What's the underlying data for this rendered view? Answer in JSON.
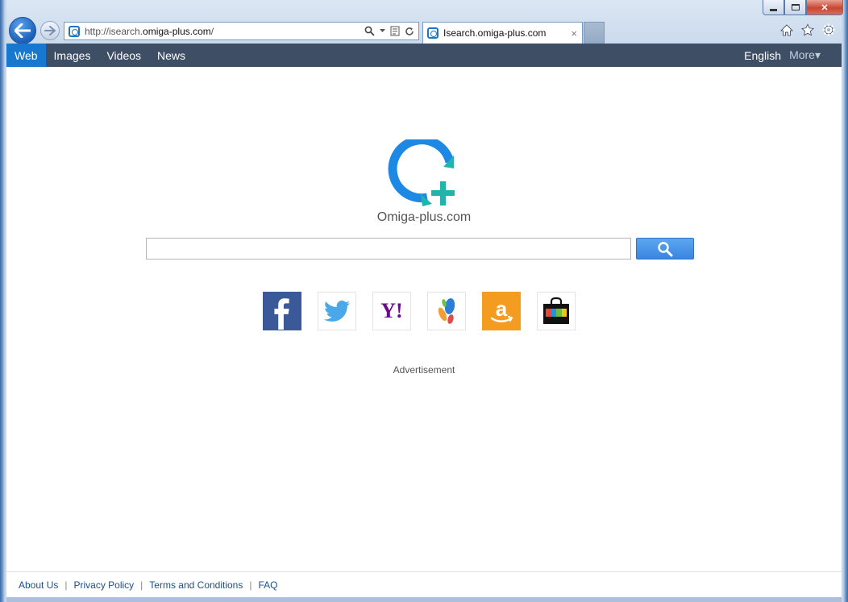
{
  "browser": {
    "url_prefix": "http://isearch.",
    "url_domain": "omiga-plus.com",
    "url_suffix": "/",
    "tab_title": "Isearch.omiga-plus.com",
    "tab_close": "×",
    "caption_close": "✕"
  },
  "menu": {
    "items": [
      {
        "label": "Web",
        "active": true
      },
      {
        "label": "Images"
      },
      {
        "label": "Videos"
      },
      {
        "label": "News"
      }
    ],
    "language": "English",
    "more": "More▾"
  },
  "brand": {
    "name": "Omiga-plus.com",
    "colors": {
      "ring": "#1e88e5",
      "plus": "#1fb5ad"
    }
  },
  "search": {
    "value": "",
    "placeholder": ""
  },
  "shortcuts": [
    {
      "name": "facebook",
      "icon": "facebook-icon"
    },
    {
      "name": "twitter",
      "icon": "twitter-icon"
    },
    {
      "name": "yahoo",
      "icon": "yahoo-icon",
      "text": "Y!"
    },
    {
      "name": "ebay-like",
      "icon": "shopping-feet-icon"
    },
    {
      "name": "amazon",
      "icon": "amazon-icon",
      "text": "a"
    },
    {
      "name": "shop",
      "icon": "shopping-bag-icon"
    }
  ],
  "ad_label": "Advertisement",
  "footer": {
    "links": [
      "About Us",
      "Privacy Policy",
      "Terms and Conditions",
      "FAQ"
    ],
    "separator": "|"
  }
}
